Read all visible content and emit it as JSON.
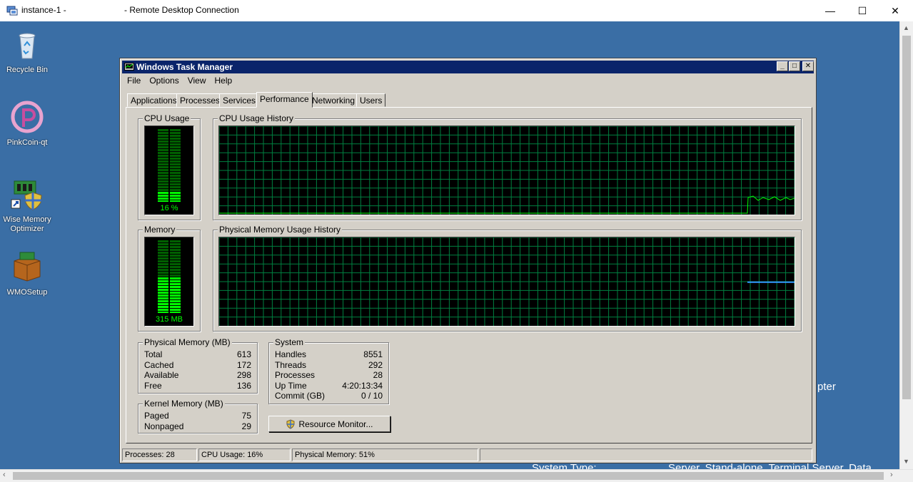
{
  "rdp": {
    "title_left": "instance-1 -",
    "title_right": "- Remote Desktop Connection",
    "minimize": "—",
    "maximize": "☐",
    "close": "✕"
  },
  "desktop": {
    "icons": [
      {
        "label": "Recycle Bin"
      },
      {
        "label": "PinkCoin-qt"
      },
      {
        "label": "Wise Memory Optimizer"
      },
      {
        "label": "WMOSetup"
      }
    ],
    "background_text": {
      "fragment1": "pter",
      "fragment2": "System Type:",
      "fragment3": "Server, Stand-alone, Terminal Server, Data"
    }
  },
  "task_manager": {
    "title": "Windows Task Manager",
    "menu": [
      "File",
      "Options",
      "View",
      "Help"
    ],
    "tabs": [
      "Applications",
      "Processes",
      "Services",
      "Performance",
      "Networking",
      "Users"
    ],
    "active_tab": "Performance",
    "cpu_usage": {
      "label": "CPU Usage",
      "value_text": "16 %",
      "value": 16
    },
    "cpu_history": {
      "label": "CPU Usage History"
    },
    "memory": {
      "label": "Memory",
      "value_text": "315 MB",
      "fraction": 0.51
    },
    "memory_history": {
      "label": "Physical Memory Usage History"
    },
    "physical_memory": {
      "label": "Physical Memory (MB)",
      "rows": [
        {
          "name": "Total",
          "value": "613"
        },
        {
          "name": "Cached",
          "value": "172"
        },
        {
          "name": "Available",
          "value": "298"
        },
        {
          "name": "Free",
          "value": "136"
        }
      ]
    },
    "kernel_memory": {
      "label": "Kernel Memory (MB)",
      "rows": [
        {
          "name": "Paged",
          "value": "75"
        },
        {
          "name": "Nonpaged",
          "value": "29"
        }
      ]
    },
    "system": {
      "label": "System",
      "rows": [
        {
          "name": "Handles",
          "value": "8551"
        },
        {
          "name": "Threads",
          "value": "292"
        },
        {
          "name": "Processes",
          "value": "28"
        },
        {
          "name": "Up Time",
          "value": "4:20:13:34"
        },
        {
          "name": "Commit (GB)",
          "value": "0 / 10"
        }
      ]
    },
    "resource_monitor_button": "Resource Monitor...",
    "status": {
      "processes": "Processes: 28",
      "cpu": "CPU Usage: 16%",
      "memory": "Physical Memory: 51%"
    }
  },
  "colors": {
    "desktop": "#3a6ea5",
    "graph_grid": "#008040",
    "graph_line": "#00ff00",
    "memory_line": "#3399ff",
    "titlebar": "#0a246a"
  }
}
